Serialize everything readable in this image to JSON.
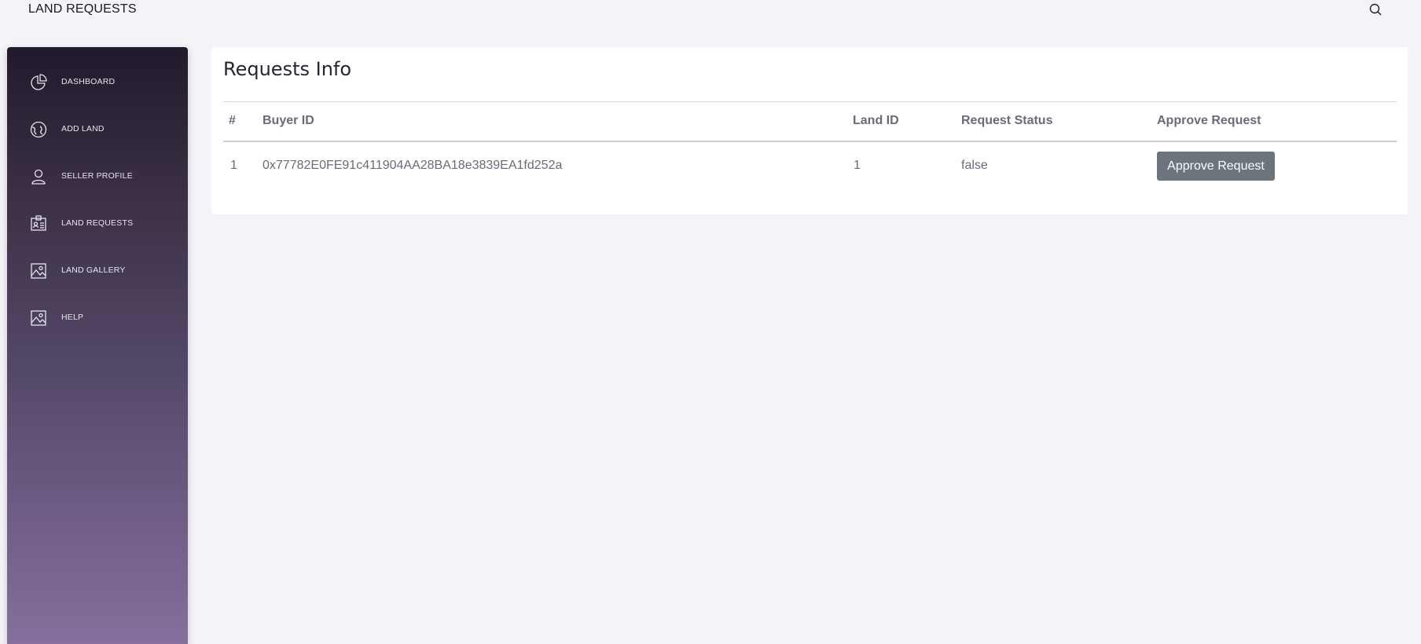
{
  "header": {
    "title": "LAND REQUESTS",
    "search_icon": "search-icon"
  },
  "sidebar": {
    "items": [
      {
        "label": "DASHBOARD",
        "icon": "pie-chart-icon"
      },
      {
        "label": "ADD LAND",
        "icon": "globe-icon"
      },
      {
        "label": "SELLER PROFILE",
        "icon": "user-icon"
      },
      {
        "label": "LAND REQUESTS",
        "icon": "badge-icon"
      },
      {
        "label": "LAND GALLERY",
        "icon": "image-icon"
      },
      {
        "label": "HELP",
        "icon": "image-icon"
      }
    ]
  },
  "main": {
    "card_title": "Requests Info",
    "table": {
      "headers": [
        "#",
        "Buyer ID",
        "Land ID",
        "Request Status",
        "Approve Request"
      ],
      "rows": [
        {
          "index": "1",
          "buyer_id": "0x77782E0FE91c411904AA28BA18e3839EA1fd252a",
          "land_id": "1",
          "status": "false",
          "action_label": "Approve Request"
        }
      ]
    }
  },
  "colors": {
    "sidebar_top": "#221a2c",
    "sidebar_bottom": "#866f9e",
    "button_bg": "#6c757d",
    "page_bg": "#f4f3f8"
  }
}
